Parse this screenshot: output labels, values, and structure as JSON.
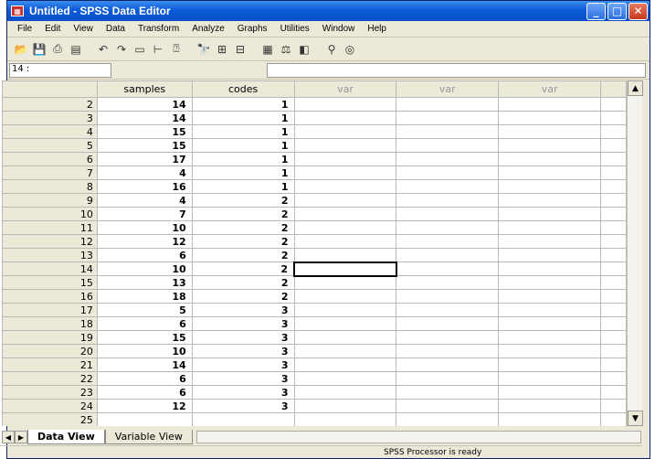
{
  "window": {
    "title": "Untitled - SPSS Data Editor"
  },
  "menu": [
    "File",
    "Edit",
    "View",
    "Data",
    "Transform",
    "Analyze",
    "Graphs",
    "Utilities",
    "Window",
    "Help"
  ],
  "cell_reference": "14 :",
  "columns": [
    "samples",
    "codes",
    "var",
    "var",
    "var"
  ],
  "rows": [
    {
      "n": "2",
      "samples": "14",
      "codes": "1"
    },
    {
      "n": "3",
      "samples": "14",
      "codes": "1"
    },
    {
      "n": "4",
      "samples": "15",
      "codes": "1"
    },
    {
      "n": "5",
      "samples": "15",
      "codes": "1"
    },
    {
      "n": "6",
      "samples": "17",
      "codes": "1"
    },
    {
      "n": "7",
      "samples": "4",
      "codes": "1"
    },
    {
      "n": "8",
      "samples": "16",
      "codes": "1"
    },
    {
      "n": "9",
      "samples": "4",
      "codes": "2"
    },
    {
      "n": "10",
      "samples": "7",
      "codes": "2"
    },
    {
      "n": "11",
      "samples": "10",
      "codes": "2"
    },
    {
      "n": "12",
      "samples": "12",
      "codes": "2"
    },
    {
      "n": "13",
      "samples": "6",
      "codes": "2"
    },
    {
      "n": "14",
      "samples": "10",
      "codes": "2"
    },
    {
      "n": "15",
      "samples": "13",
      "codes": "2"
    },
    {
      "n": "16",
      "samples": "18",
      "codes": "2"
    },
    {
      "n": "17",
      "samples": "5",
      "codes": "3"
    },
    {
      "n": "18",
      "samples": "6",
      "codes": "3"
    },
    {
      "n": "19",
      "samples": "15",
      "codes": "3"
    },
    {
      "n": "20",
      "samples": "10",
      "codes": "3"
    },
    {
      "n": "21",
      "samples": "14",
      "codes": "3"
    },
    {
      "n": "22",
      "samples": "6",
      "codes": "3"
    },
    {
      "n": "23",
      "samples": "6",
      "codes": "3"
    },
    {
      "n": "24",
      "samples": "12",
      "codes": "3"
    },
    {
      "n": "25",
      "samples": "",
      "codes": ""
    }
  ],
  "tabs": {
    "data_view": "Data View",
    "variable_view": "Variable View"
  },
  "status": "SPSS Processor  is ready"
}
